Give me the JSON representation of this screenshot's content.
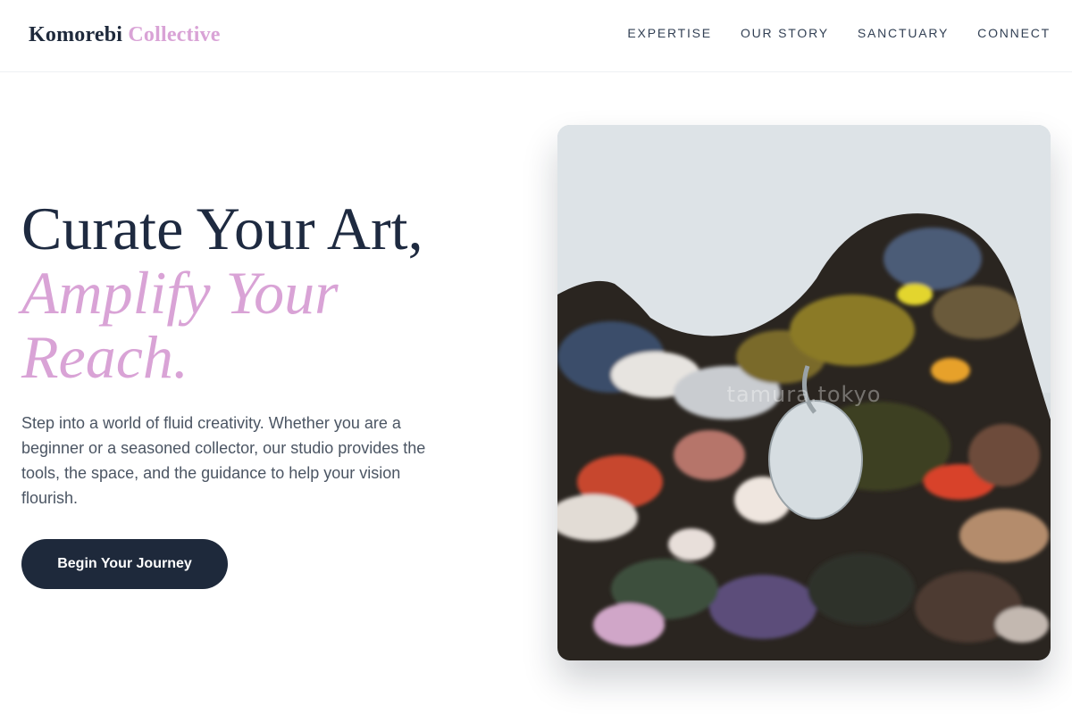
{
  "header": {
    "logo_primary": "Komorebi",
    "logo_accent": "Collective",
    "nav": [
      {
        "label": "EXPERTISE"
      },
      {
        "label": "OUR STORY"
      },
      {
        "label": "SANCTUARY"
      },
      {
        "label": "CONNECT"
      }
    ]
  },
  "hero": {
    "title_line1": "Curate Your Art,",
    "title_accent_line1": "Amplify Your",
    "title_accent_line2": "Reach.",
    "description": "Step into a world of fluid creativity. Whether you are a beginner or a seasoned collector, our studio provides the tools, the space, and the guidance to help your vision flourish.",
    "cta_label": "Begin Your Journey",
    "image": {
      "subject": "paint-palette-photo",
      "watermark": "tamura.tokyo"
    }
  },
  "colors": {
    "primary": "#1e293b",
    "accent": "#d9a3d6",
    "text_muted": "#4b5563",
    "background": "#ffffff"
  }
}
